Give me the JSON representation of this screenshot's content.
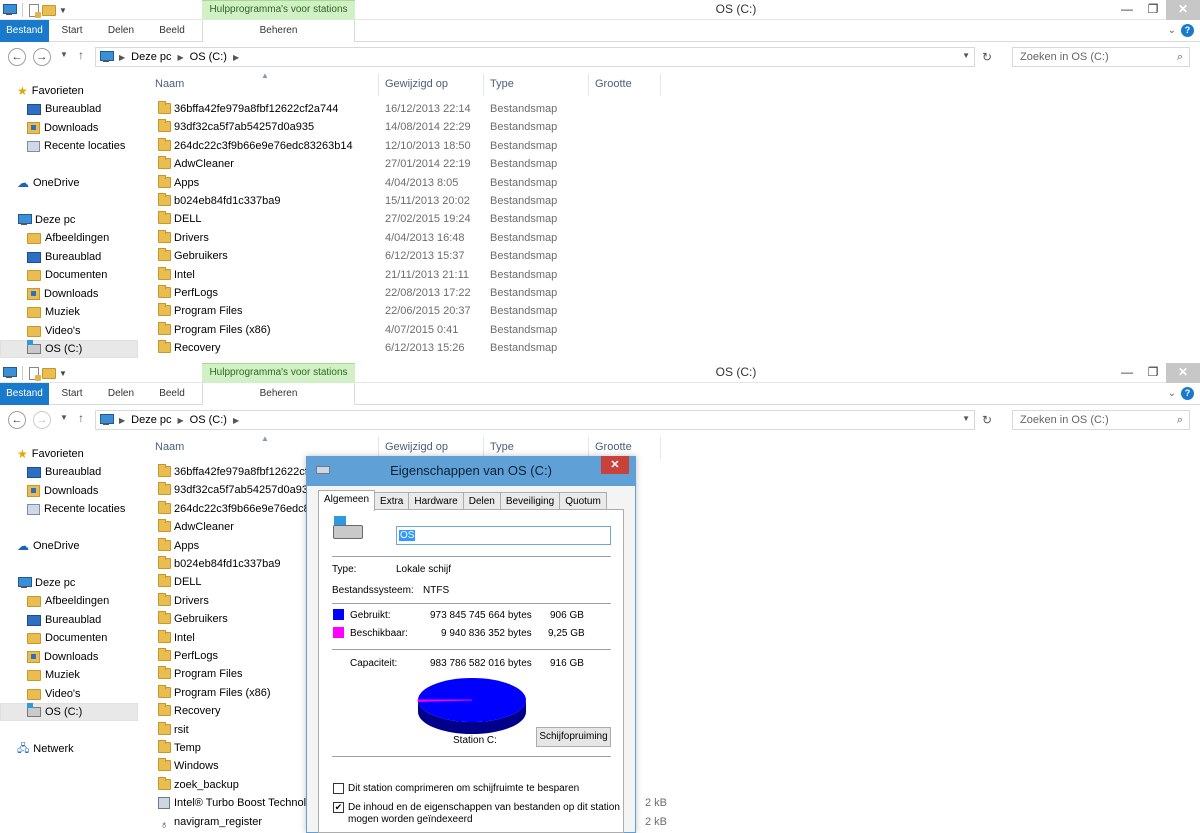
{
  "window_top": {
    "title": "OS (C:)",
    "hulp_label": "Hulpprogramma's voor stations",
    "ribbon_tabs": {
      "file": "Bestand",
      "start": "Start",
      "share": "Delen",
      "view": "Beeld",
      "manage": "Beheren"
    },
    "breadcrumb": {
      "root": "Deze pc",
      "current": "OS (C:)"
    },
    "search_placeholder": "Zoeken in OS (C:)",
    "columns": {
      "name": "Naam",
      "modified": "Gewijzigd op",
      "type": "Type",
      "size": "Grootte"
    },
    "files": [
      {
        "name": "36bffa42fe979a8fbf12622cf2a744",
        "date": "16/12/2013 22:14",
        "type": "Bestandsmap"
      },
      {
        "name": "93df32ca5f7ab54257d0a935",
        "date": "14/08/2014 22:29",
        "type": "Bestandsmap"
      },
      {
        "name": "264dc22c3f9b66e9e76edc83263b14",
        "date": "12/10/2013 18:50",
        "type": "Bestandsmap"
      },
      {
        "name": "AdwCleaner",
        "date": "27/01/2014 22:19",
        "type": "Bestandsmap"
      },
      {
        "name": "Apps",
        "date": "4/04/2013 8:05",
        "type": "Bestandsmap"
      },
      {
        "name": "b024eb84fd1c337ba9",
        "date": "15/11/2013 20:02",
        "type": "Bestandsmap"
      },
      {
        "name": "DELL",
        "date": "27/02/2015 19:24",
        "type": "Bestandsmap"
      },
      {
        "name": "Drivers",
        "date": "4/04/2013 16:48",
        "type": "Bestandsmap"
      },
      {
        "name": "Gebruikers",
        "date": "6/12/2013 15:37",
        "type": "Bestandsmap"
      },
      {
        "name": "Intel",
        "date": "21/11/2013 21:11",
        "type": "Bestandsmap"
      },
      {
        "name": "PerfLogs",
        "date": "22/08/2013 17:22",
        "type": "Bestandsmap"
      },
      {
        "name": "Program Files",
        "date": "22/06/2015 20:37",
        "type": "Bestandsmap"
      },
      {
        "name": "Program Files (x86)",
        "date": "4/07/2015 0:41",
        "type": "Bestandsmap"
      },
      {
        "name": "Recovery",
        "date": "6/12/2013 15:26",
        "type": "Bestandsmap"
      }
    ]
  },
  "sidebar": {
    "favorites": "Favorieten",
    "fav_items": [
      "Bureaublad",
      "Downloads",
      "Recente locaties"
    ],
    "onedrive": "OneDrive",
    "thispc": "Deze pc",
    "pc_items": [
      "Afbeeldingen",
      "Bureaublad",
      "Documenten",
      "Downloads",
      "Muziek",
      "Video's",
      "OS (C:)"
    ],
    "network": "Netwerk"
  },
  "window_bottom": {
    "title": "OS (C:)",
    "files": [
      {
        "name": "36bffa42fe979a8fbf12622cf2a",
        "size": ""
      },
      {
        "name": "93df32ca5f7ab54257d0a935",
        "size": ""
      },
      {
        "name": "264dc22c3f9b66e9e76edc832",
        "size": ""
      },
      {
        "name": "AdwCleaner",
        "size": ""
      },
      {
        "name": "Apps",
        "size": ""
      },
      {
        "name": "b024eb84fd1c337ba9",
        "size": ""
      },
      {
        "name": "DELL",
        "size": ""
      },
      {
        "name": "Drivers",
        "size": ""
      },
      {
        "name": "Gebruikers",
        "size": ""
      },
      {
        "name": "Intel",
        "size": ""
      },
      {
        "name": "PerfLogs",
        "size": ""
      },
      {
        "name": "Program Files",
        "size": ""
      },
      {
        "name": "Program Files (x86)",
        "size": ""
      },
      {
        "name": "Recovery",
        "size": ""
      },
      {
        "name": "rsit",
        "size": ""
      },
      {
        "name": "Temp",
        "size": ""
      },
      {
        "name": "Windows",
        "size": ""
      },
      {
        "name": "zoek_backup",
        "size": ""
      },
      {
        "name": "Intel® Turbo Boost Technolo",
        "size": "2 kB"
      },
      {
        "name": "navigram_register",
        "size": "2 kB"
      }
    ]
  },
  "dialog": {
    "title": "Eigenschappen van OS (C:)",
    "tabs": [
      "Algemeen",
      "Extra",
      "Hardware",
      "Delen",
      "Beveiliging",
      "Quotum"
    ],
    "drive_name": "OS",
    "type_label": "Type:",
    "type_value": "Lokale schijf",
    "fs_label": "Bestandssysteem:",
    "fs_value": "NTFS",
    "used_label": "Gebruikt:",
    "used_bytes": "973 845 745 664 bytes",
    "used_gb": "906 GB",
    "free_label": "Beschikbaar:",
    "free_bytes": "9 940 836 352 bytes",
    "free_gb": "9,25 GB",
    "cap_label": "Capaciteit:",
    "cap_bytes": "983 786 582 016 bytes",
    "cap_gb": "916 GB",
    "station_label": "Station C:",
    "cleanup_button": "Schijfopruiming",
    "compress_label": "Dit station comprimeren om schijfruimte te besparen",
    "compress_checked": false,
    "index_label_1": "De inhoud en de eigenschappen van bestanden op dit station",
    "index_label_2": "mogen worden geïndexeerd",
    "index_checked": true,
    "used_color": "#0000ff",
    "free_color": "#ff00ff",
    "free_fraction": 0.0101
  }
}
